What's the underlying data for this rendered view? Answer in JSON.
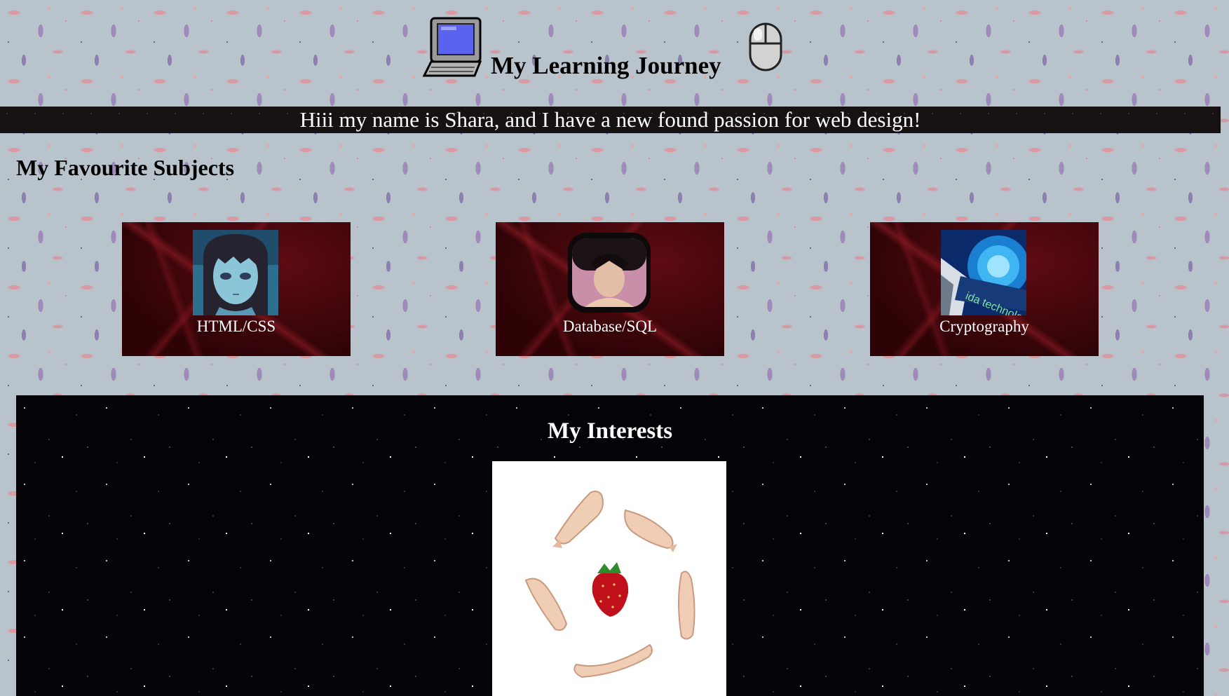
{
  "header": {
    "title": "My Learning Journey",
    "left_icon": "laptop-icon",
    "right_icon": "computer-mouse-icon"
  },
  "intro": {
    "text": "Hiii my name is Shara, and I have a new found passion for web design!"
  },
  "subjects": {
    "heading": "My Favourite Subjects",
    "cards": [
      {
        "label": "HTML/CSS",
        "image": "anime-girl-portrait"
      },
      {
        "label": "Database/SQL",
        "image": "retro-crt-portrait"
      },
      {
        "label": "Cryptography",
        "image": "technology-globe-image"
      }
    ]
  },
  "interests": {
    "title": "My Interests",
    "image": "hands-circling-strawberry"
  },
  "colors": {
    "page_background": "#b9c3cc",
    "intro_bar": "#161214",
    "card_background": "#3c0408",
    "interests_background": "#030308",
    "text_light": "#ffffff",
    "text_dark": "#000000"
  }
}
